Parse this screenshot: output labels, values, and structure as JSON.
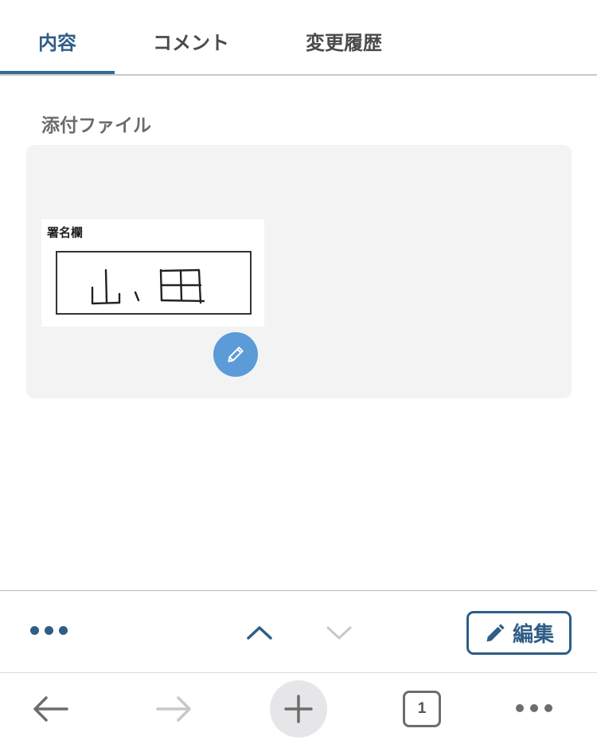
{
  "tabs": [
    {
      "label": "内容",
      "active": true
    },
    {
      "label": "コメント",
      "active": false
    },
    {
      "label": "変更履歴",
      "active": false
    }
  ],
  "section": {
    "label": "添付ファイル"
  },
  "attachment": {
    "caption": "署名欄",
    "signature_text": "山 田",
    "edit_icon": "pencil-icon"
  },
  "action_bar": {
    "more_icon": "ellipsis-icon",
    "up_icon": "chevron-up-icon",
    "down_icon": "chevron-down-icon",
    "edit_label": "編集"
  },
  "browser_bar": {
    "tab_count": "1"
  },
  "colors": {
    "accent": "#2f5d86",
    "fab": "#5a9bd8",
    "box_bg": "#f3f3f3"
  }
}
